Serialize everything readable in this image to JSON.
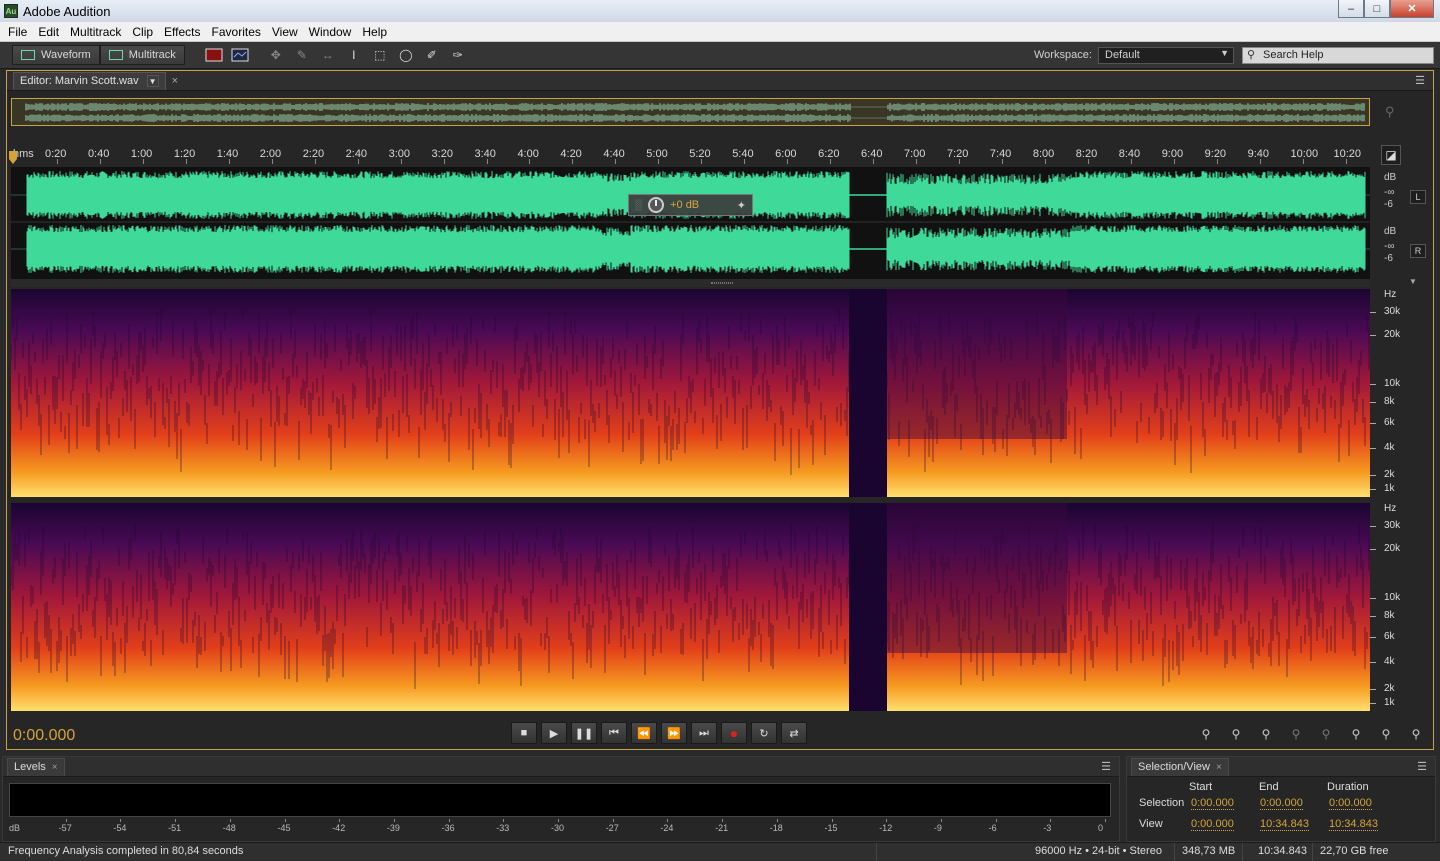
{
  "app": {
    "title": "Adobe Audition",
    "logo": "Au"
  },
  "menu": [
    "File",
    "Edit",
    "Multitrack",
    "Clip",
    "Effects",
    "Favorites",
    "View",
    "Window",
    "Help"
  ],
  "toolbar": {
    "waveform_label": "Waveform",
    "multitrack_label": "Multitrack",
    "workspace_label": "Workspace:",
    "workspace_value": "Default",
    "search_placeholder": "Search Help"
  },
  "editor": {
    "tab_label": "Editor: Marvin Scott.wav",
    "ruler_unit": "hms",
    "ruler_ticks": [
      "0:20",
      "0:40",
      "1:00",
      "1:20",
      "1:40",
      "2:00",
      "2:20",
      "2:40",
      "3:00",
      "3:20",
      "3:40",
      "4:00",
      "4:20",
      "4:40",
      "5:00",
      "5:20",
      "5:40",
      "6:00",
      "6:20",
      "6:40",
      "7:00",
      "7:20",
      "7:40",
      "8:00",
      "8:20",
      "8:40",
      "9:00",
      "9:20",
      "9:40",
      "10:00",
      "10:20"
    ],
    "hud_value": "+0 dB",
    "channels": [
      {
        "label": "L",
        "db": [
          "dB",
          "-∞",
          "-6"
        ]
      },
      {
        "label": "R",
        "db": [
          "dB",
          "-∞",
          "-6"
        ]
      }
    ],
    "hz_labels": [
      "Hz",
      "30k",
      "20k",
      "10k",
      "8k",
      "6k",
      "4k",
      "2k",
      "1k"
    ],
    "time_display": "0:00.000",
    "colors": {
      "waveform": "#3fd99a",
      "accent": "#d4a43a",
      "frame": "#c7a44a"
    }
  },
  "levels": {
    "tab_label": "Levels",
    "scale": [
      "dB",
      "-57",
      "-54",
      "-51",
      "-48",
      "-45",
      "-42",
      "-39",
      "-36",
      "-33",
      "-30",
      "-27",
      "-24",
      "-21",
      "-18",
      "-15",
      "-12",
      "-9",
      "-6",
      "-3",
      "0"
    ]
  },
  "selection_view": {
    "tab_label": "Selection/View",
    "headers": {
      "start": "Start",
      "end": "End",
      "duration": "Duration"
    },
    "selection": {
      "label": "Selection",
      "start": "0:00.000",
      "end": "0:00.000",
      "duration": "0:00.000"
    },
    "view": {
      "label": "View",
      "start": "0:00.000",
      "end": "10:34.843",
      "duration": "10:34.843"
    }
  },
  "status": {
    "message": "Frequency Analysis completed in 80,84 seconds",
    "format": "96000 Hz • 24-bit • Stereo",
    "size": "348,73 MB",
    "duration": "10:34.843",
    "free": "22,70 GB free"
  }
}
